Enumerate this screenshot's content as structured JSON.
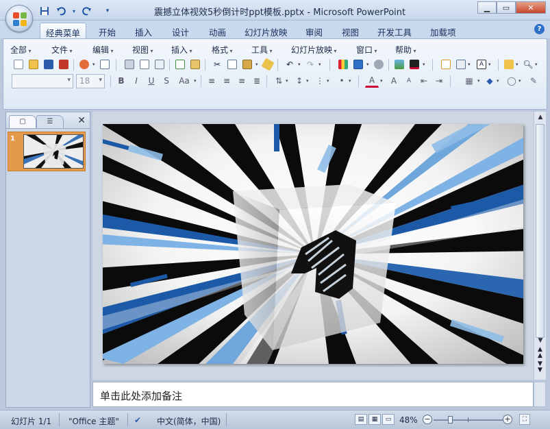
{
  "window": {
    "title": "震撼立体视效5秒倒计时ppt模板.pptx - Microsoft PowerPoint",
    "controls": [
      "minimize",
      "maximize",
      "close"
    ]
  },
  "ribbon_tabs": [
    {
      "label": "经典菜单",
      "active": true
    },
    {
      "label": "开始"
    },
    {
      "label": "插入"
    },
    {
      "label": "设计"
    },
    {
      "label": "动画"
    },
    {
      "label": "幻灯片放映"
    },
    {
      "label": "审阅"
    },
    {
      "label": "视图"
    },
    {
      "label": "开发工具"
    },
    {
      "label": "加载项"
    }
  ],
  "menus": [
    "全部",
    "文件",
    "编辑",
    "视图",
    "插入",
    "格式",
    "工具",
    "幻灯片放映",
    "窗口",
    "帮助"
  ],
  "font": {
    "name_placeholder": "",
    "size": "18"
  },
  "slides_panel": {
    "tabs": [
      "slides-tab",
      "outline-tab"
    ],
    "slide_number": "1"
  },
  "slide": {
    "digit": "1"
  },
  "notes": {
    "placeholder": "单击此处添加备注"
  },
  "status": {
    "slide": "幻灯片 1/1",
    "theme": "\"Office 主题\"",
    "language": "中文(简体，中国)",
    "zoom": "48%",
    "zoom_level": 0.48
  },
  "colors": {
    "accent_blue": "#1c5aa8",
    "light_blue": "#7fb2e5",
    "thumbnail_highlight": "#e39a4a"
  }
}
